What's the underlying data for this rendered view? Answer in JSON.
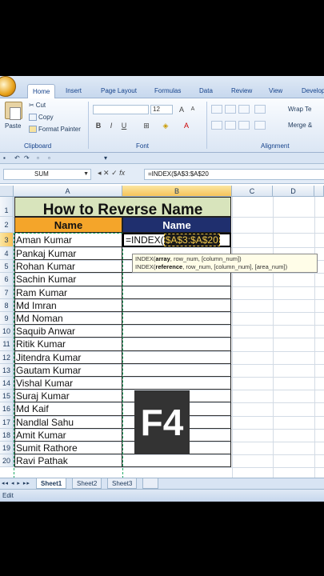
{
  "ribbon": {
    "tabs": [
      "Home",
      "Insert",
      "Page Layout",
      "Formulas",
      "Data",
      "Review",
      "View",
      "Develop"
    ],
    "clipboard": {
      "paste": "Paste",
      "cut": "Cut",
      "copy": "Copy",
      "format_painter": "Format Painter",
      "label": "Clipboard"
    },
    "font": {
      "font_name": "",
      "font_size": "12",
      "label": "Font",
      "bold": "B",
      "italic": "I",
      "underline": "U"
    },
    "alignment": {
      "wrap_text": "Wrap Te",
      "merge": "Merge &",
      "label": "Alignment"
    }
  },
  "formula_bar": {
    "name_box": "SUM",
    "fx": "fx",
    "formula": "=INDEX($A$3:$A$20"
  },
  "columns": [
    "A",
    "B",
    "C",
    "D"
  ],
  "rows": [
    "1",
    "2",
    "3",
    "4",
    "5",
    "6",
    "7",
    "8",
    "9",
    "10",
    "11",
    "12",
    "13",
    "14",
    "15",
    "16",
    "17",
    "18",
    "19",
    "20"
  ],
  "sheet": {
    "title": "How to Reverse Name",
    "header_a": "Name",
    "header_b": "Name",
    "names": [
      "Aman Kumar",
      "Pankaj Kumar",
      "Rohan Kumar",
      "Sachin Kumar",
      "Ram Kumar",
      "Md Imran",
      "Md Noman",
      "Saquib Anwar",
      "Ritik Kumar",
      "Jitendra Kumar",
      "Gautam Kumar",
      "Vishal Kumar",
      "Suraj Kumar",
      "Md Kaif",
      "Nandlal Sahu",
      "Amit Kumar",
      "Sumit Rathore",
      "Ravi Pathak"
    ],
    "active_formula_prefix": "=INDEX(",
    "active_formula_ref": "$A$3:$A$20"
  },
  "tooltip": {
    "line1_fn": "INDEX(",
    "line1_bold": "array",
    "line1_rest": ", row_num, [column_num])",
    "line2_fn": "INDEX(",
    "line2_bold": "reference",
    "line2_rest": ", row_num, [column_num], [area_num])"
  },
  "overlay_key": "F4",
  "sheet_tabs": [
    "Sheet1",
    "Sheet2",
    "Sheet3"
  ],
  "status": "Edit"
}
